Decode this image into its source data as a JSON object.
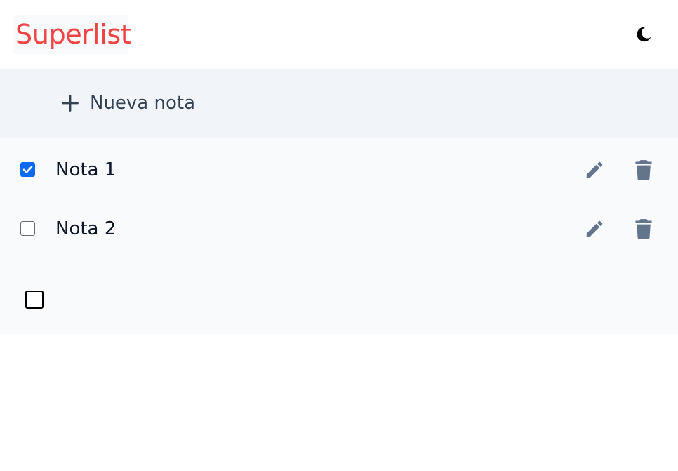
{
  "header": {
    "brand": "Superlist",
    "theme_icon": "moon-icon",
    "brand_color": "#ef4444"
  },
  "toolbar": {
    "new_note_label": "Nueva nota",
    "new_note_icon": "plus-icon"
  },
  "notes": [
    {
      "title": "Nota 1",
      "checked": true
    },
    {
      "title": "Nota 2",
      "checked": false
    }
  ],
  "icons": {
    "edit": "pencil-icon",
    "delete": "trash-icon"
  },
  "colors": {
    "accent": "#ef4444",
    "checkbox_on": "#0b6bf0",
    "icon_gray": "#64748b",
    "toolbar_bg": "#f1f5f9",
    "list_bg": "#f8fafc"
  }
}
